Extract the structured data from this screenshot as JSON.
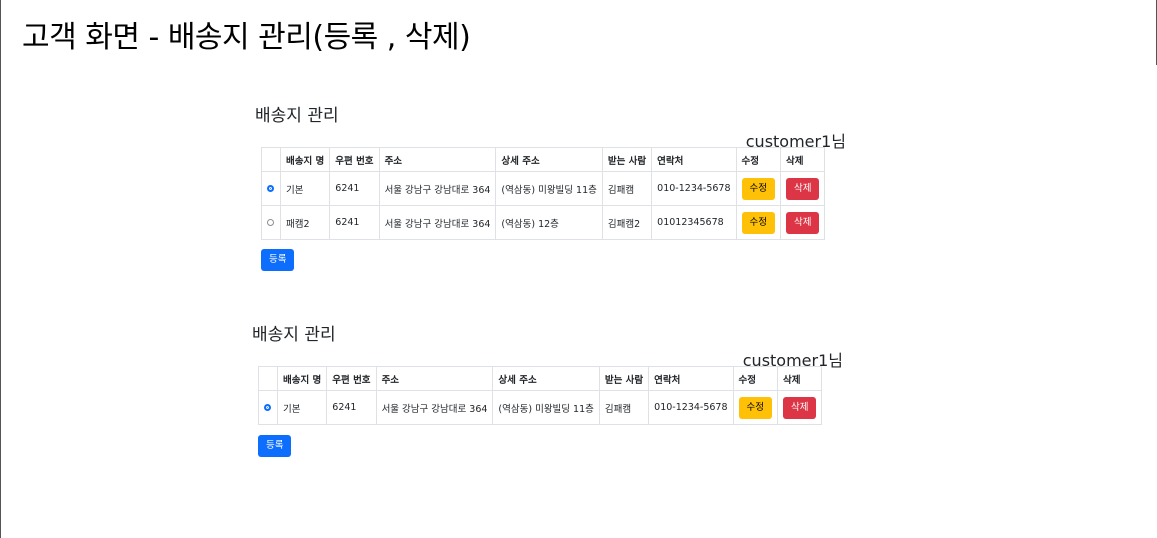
{
  "page_title": "고객 화면 - 배송지 관리(등록 , 삭제)",
  "sections": [
    {
      "title": "배송지 관리",
      "customer": "customer1님",
      "headers": [
        "",
        "배송지 명",
        "우편 번호",
        "주소",
        "상세 주소",
        "받는 사람",
        "연락처",
        "수정",
        "삭제"
      ],
      "rows": [
        {
          "selected": true,
          "name": "기본",
          "zip": "6241",
          "address": "서울 강남구 강남대로 364",
          "detail": "(역삼동) 미왕빌딩 11층",
          "receiver": "김패캠",
          "phone": "010-1234-5678",
          "edit": "수정",
          "delete": "삭제"
        },
        {
          "selected": false,
          "name": "패캠2",
          "zip": "6241",
          "address": "서울 강남구 강남대로 364",
          "detail": "(역삼동) 12층",
          "receiver": "김패캠2",
          "phone": "01012345678",
          "edit": "수정",
          "delete": "삭제"
        }
      ],
      "register_label": "등록"
    },
    {
      "title": "배송지 관리",
      "customer": "customer1님",
      "headers": [
        "",
        "배송지 명",
        "우편 번호",
        "주소",
        "상세 주소",
        "받는 사람",
        "연락처",
        "수정",
        "삭제"
      ],
      "rows": [
        {
          "selected": true,
          "name": "기본",
          "zip": "6241",
          "address": "서울 강남구 강남대로 364",
          "detail": "(역삼동) 미왕빌딩 11층",
          "receiver": "김패캠",
          "phone": "010-1234-5678",
          "edit": "수정",
          "delete": "삭제"
        }
      ],
      "register_label": "등록"
    }
  ],
  "colors": {
    "primary": "#0d6efd",
    "warning": "#ffc107",
    "danger": "#dc3545"
  }
}
